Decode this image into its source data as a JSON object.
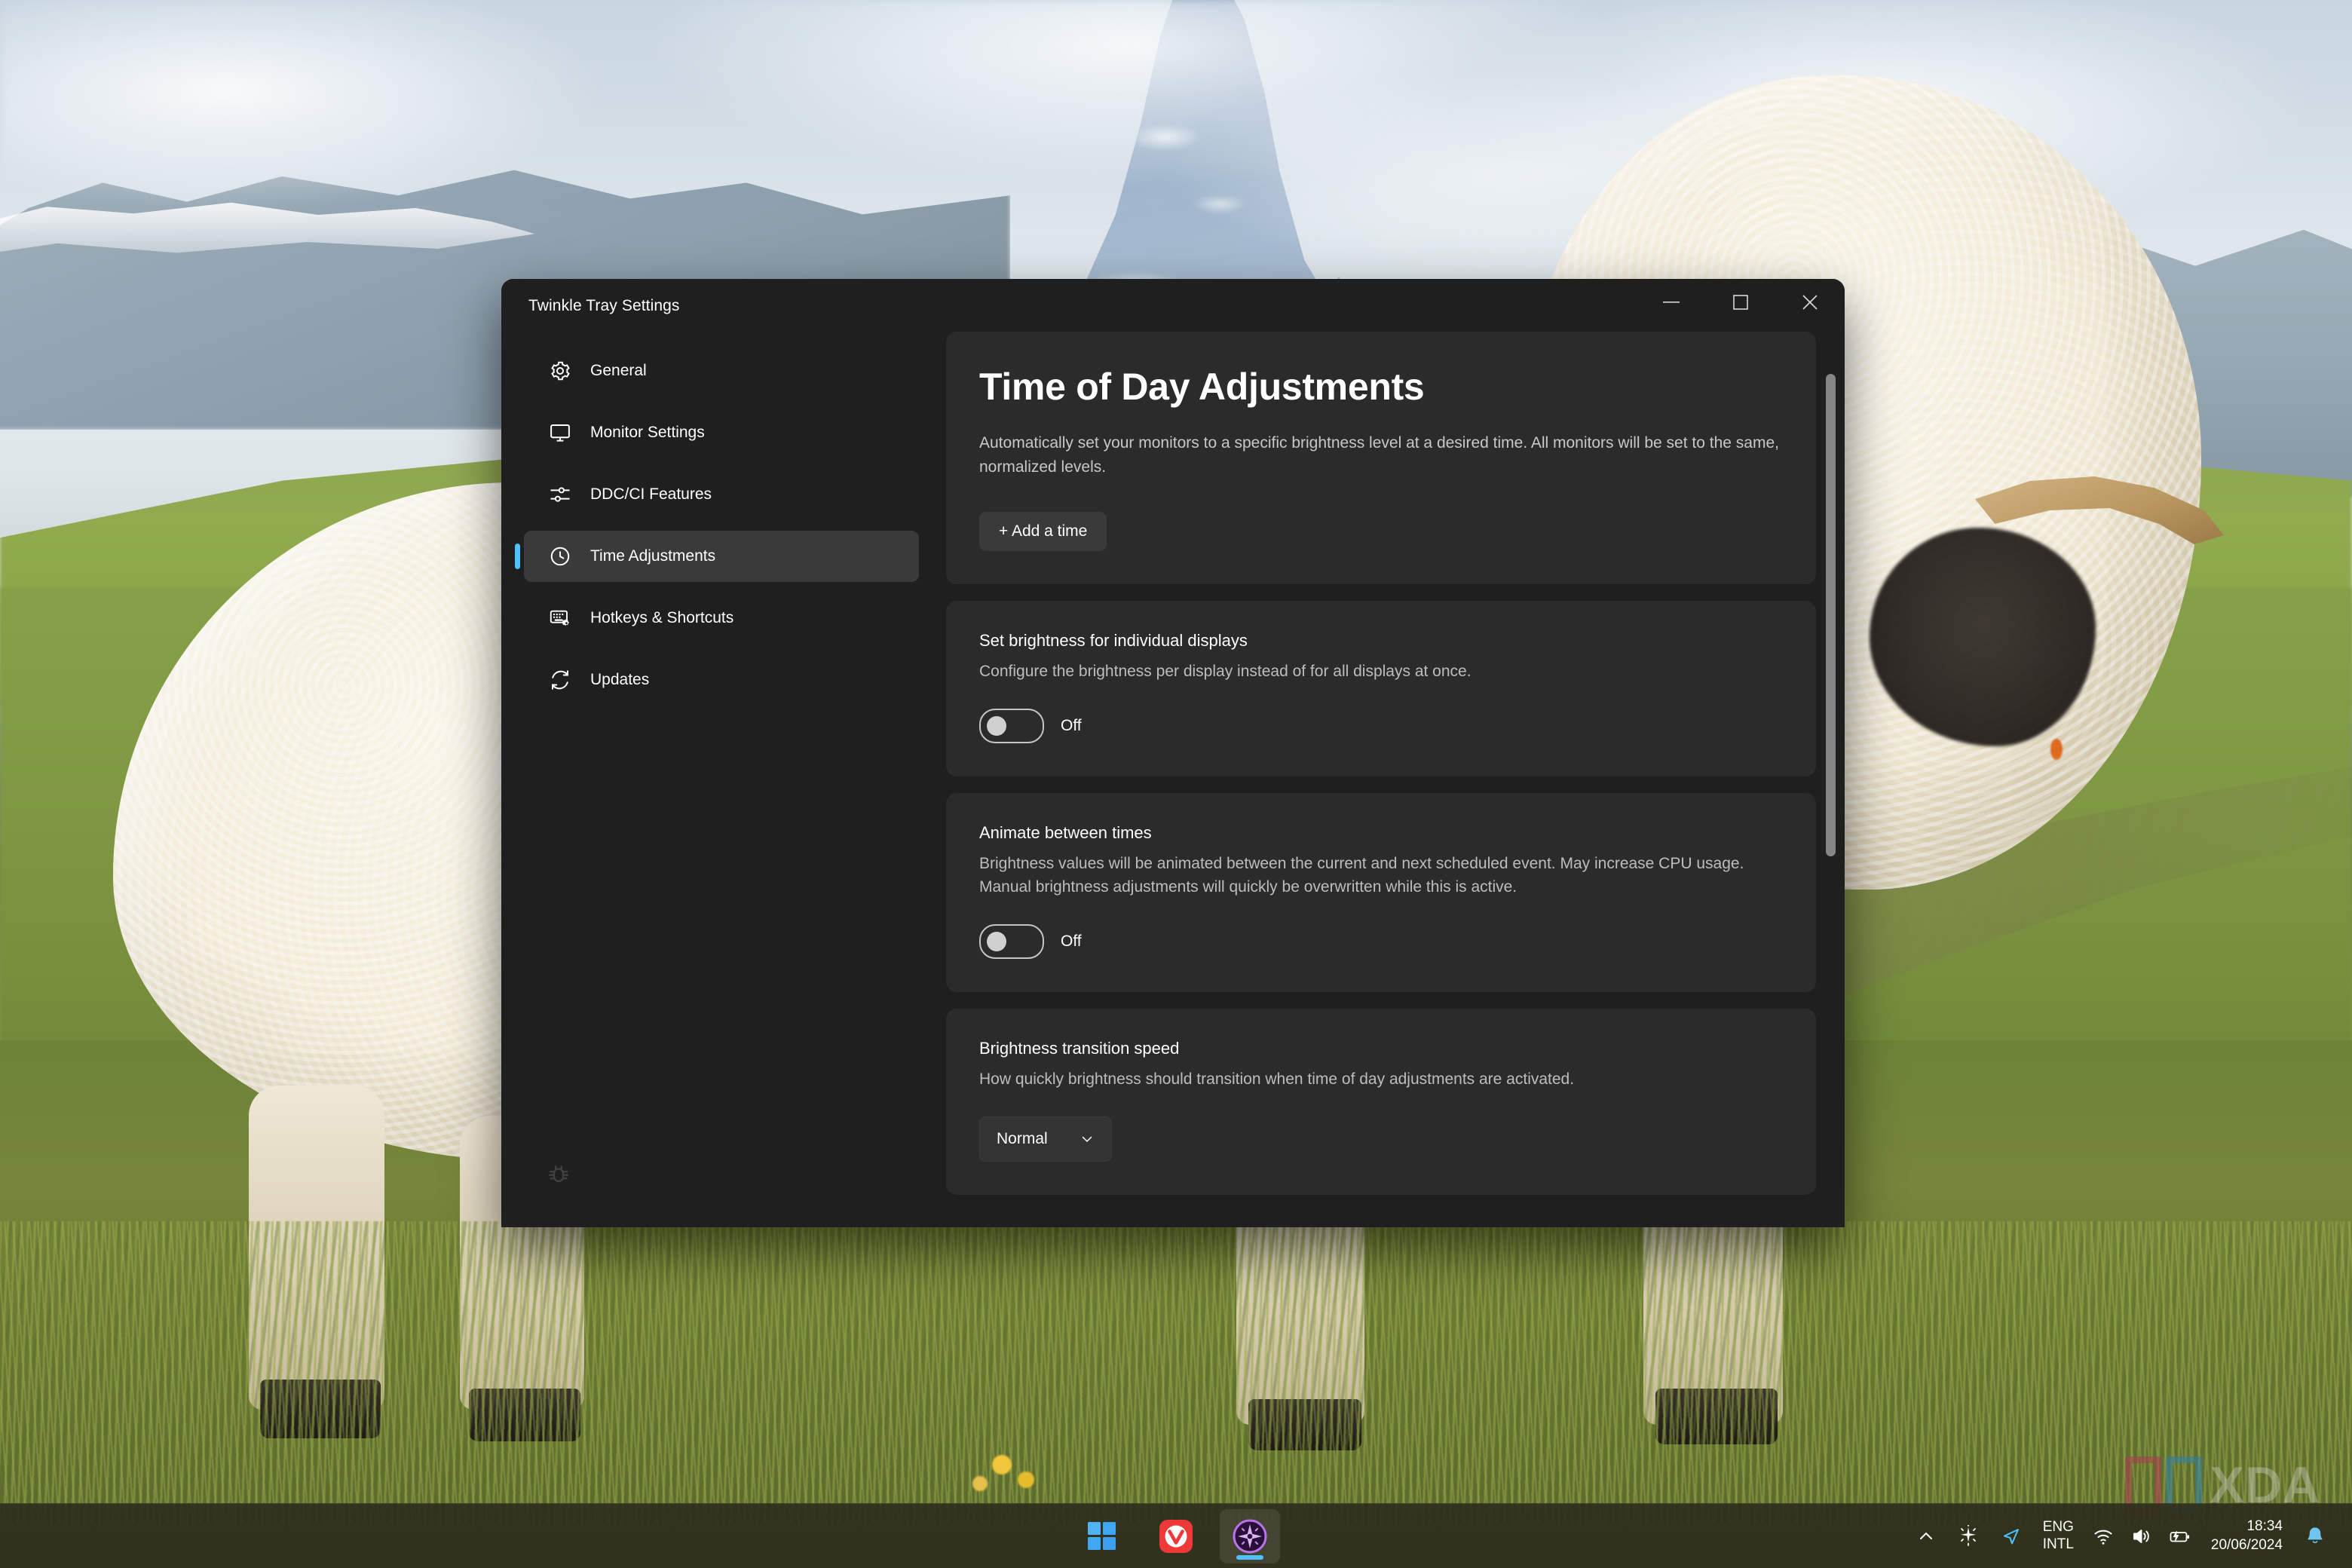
{
  "window": {
    "title": "Twinkle Tray Settings",
    "controls": {
      "minimize": "minimize-icon",
      "maximize": "maximize-icon",
      "close": "close-icon"
    }
  },
  "sidebar": {
    "items": [
      {
        "label": "General",
        "icon": "gear-icon",
        "active": false
      },
      {
        "label": "Monitor Settings",
        "icon": "monitor-icon",
        "active": false
      },
      {
        "label": "DDC/CI Features",
        "icon": "sliders-icon",
        "active": false
      },
      {
        "label": "Time Adjustments",
        "icon": "clock-icon",
        "active": true
      },
      {
        "label": "Hotkeys & Shortcuts",
        "icon": "keyboard-icon",
        "active": false
      },
      {
        "label": "Updates",
        "icon": "refresh-icon",
        "active": false
      }
    ],
    "footer_icon": "bug-icon",
    "accent_color": "#4cc2ff"
  },
  "main": {
    "title": "Time of Day Adjustments",
    "description": "Automatically set your monitors to a specific brightness level at a desired time. All monitors will be set to the same, normalized levels.",
    "add_time_button": "+ Add a time",
    "settings": [
      {
        "title": "Set brightness for individual displays",
        "description": "Configure the brightness per display instead of for all displays at once.",
        "control": "toggle",
        "value": "Off"
      },
      {
        "title": "Animate between times",
        "description": "Brightness values will be animated between the current and next scheduled event. May increase CPU usage. Manual brightness adjustments will quickly be overwritten while this is active.",
        "control": "toggle",
        "value": "Off"
      },
      {
        "title": "Brightness transition speed",
        "description": "How quickly brightness should transition when time of day adjustments are activated.",
        "control": "select",
        "value": "Normal"
      }
    ]
  },
  "taskbar": {
    "apps": [
      {
        "name": "start-button",
        "label": "Start"
      },
      {
        "name": "vivaldi-app",
        "label": "Vivaldi"
      },
      {
        "name": "twinkle-tray-app",
        "label": "Twinkle Tray"
      }
    ],
    "tray": {
      "chevron": "show-hidden-icons",
      "twinkle": "twinkle-tray-tray-icon",
      "location": "location-icon",
      "language_top": "ENG",
      "language_bottom": "INTL",
      "wifi": "wifi-icon",
      "volume": "volume-icon",
      "battery": "battery-charging-icon",
      "time": "18:34",
      "date": "20/06/2024",
      "notifications": "bell-icon"
    }
  },
  "watermark": {
    "word": "XDA",
    "block_colors": [
      "#b03a52",
      "#2f7fa8"
    ]
  }
}
